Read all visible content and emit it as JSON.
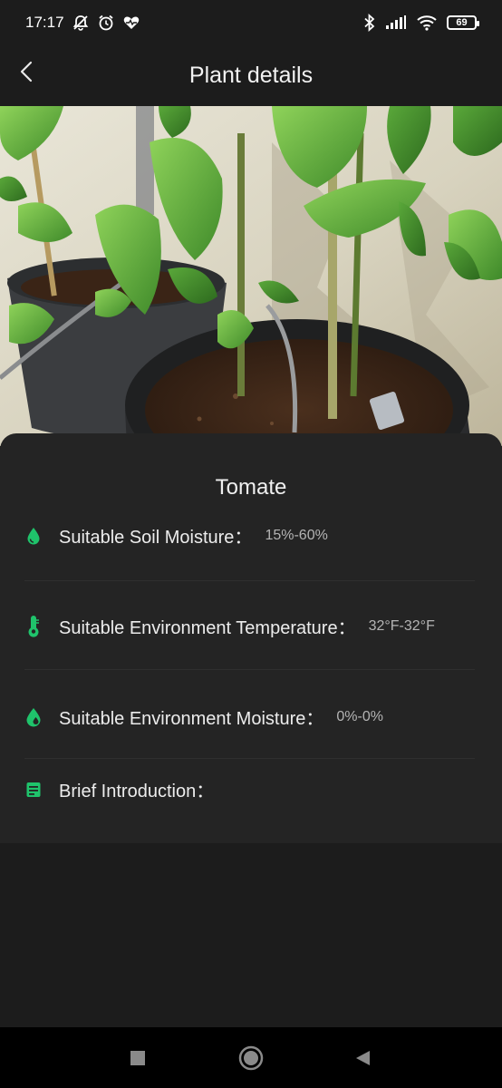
{
  "status_bar": {
    "time": "17:17",
    "battery": "69",
    "icons": [
      "bell-off-icon",
      "alarm-icon",
      "heart-rate-icon",
      "bluetooth-icon",
      "signal-icon",
      "wifi-icon",
      "battery-icon"
    ]
  },
  "header": {
    "title": "Plant details",
    "back_icon": "back-chevron-icon"
  },
  "plant": {
    "name": "Tomate",
    "soil_moisture_label": "Suitable Soil Moisture：",
    "soil_moisture_value": "15%-60%",
    "env_temperature_label": "Suitable Environment Temperature：",
    "env_temperature_value": "32°F-32°F",
    "env_moisture_label": "Suitable Environment Moisture：",
    "env_moisture_value": "0%-0%",
    "intro_label": "Brief Introduction："
  },
  "colors": {
    "accent": "#1fc36b",
    "background": "#1c1c1c",
    "sheet": "#242424"
  },
  "nav_bar": {
    "icons": [
      "recents-square-icon",
      "home-circle-icon",
      "back-triangle-icon"
    ]
  }
}
